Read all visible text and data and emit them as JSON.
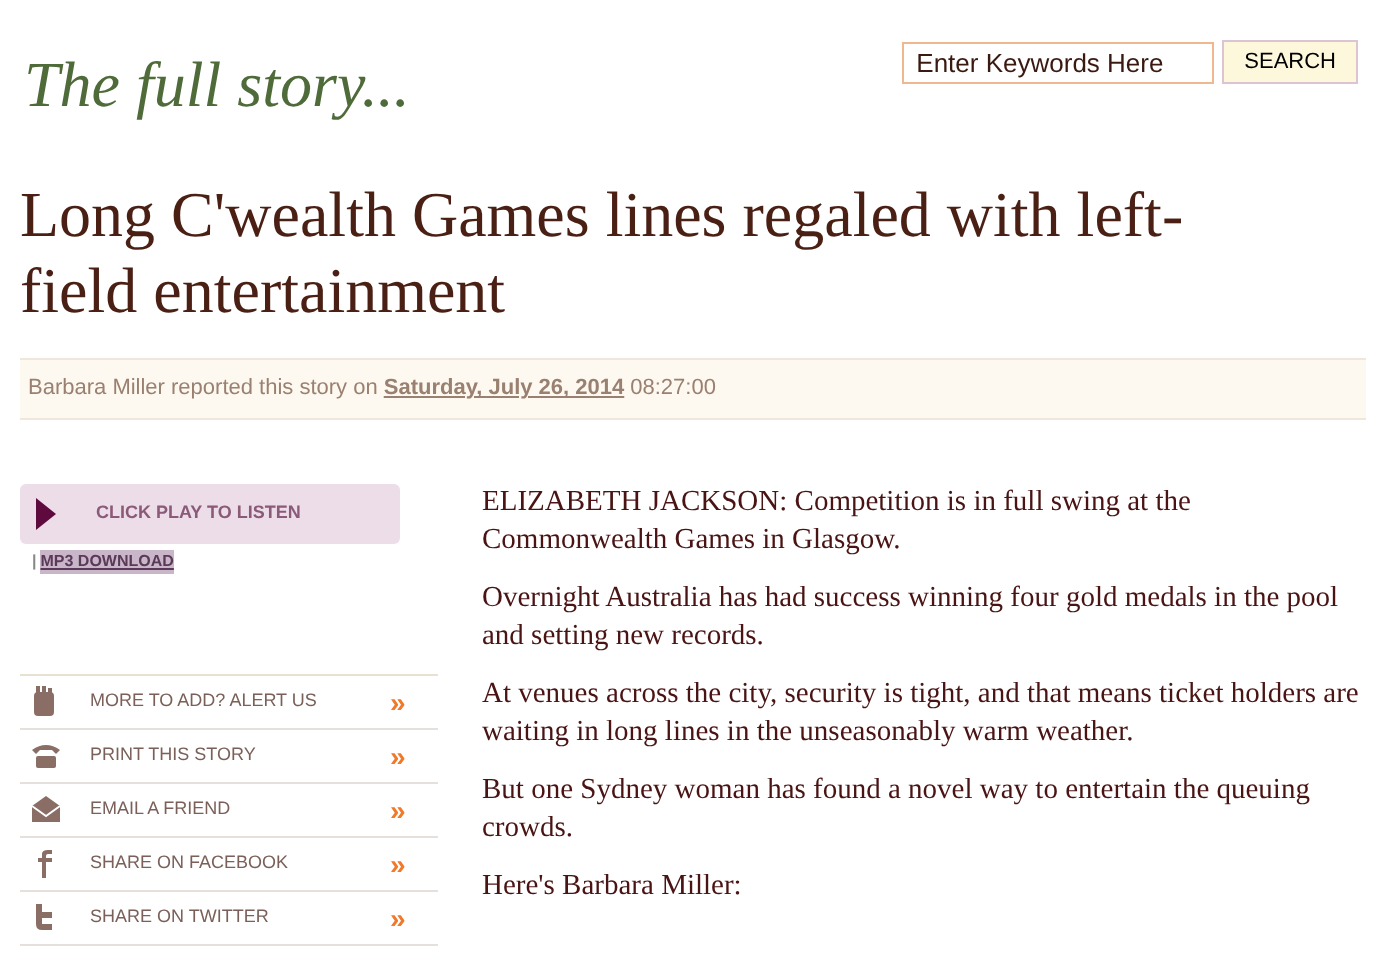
{
  "section_title": "The full story...",
  "search": {
    "value": "Enter Keywords Here",
    "button": "SEARCH"
  },
  "headline": "Long C'wealth Games lines regaled with left-field entertainment",
  "byline": {
    "text": "Barbara Miller reported this story on",
    "date": "Saturday, July 26, 2014",
    "time": "08:27:00"
  },
  "audio": {
    "play_label": "CLICK PLAY TO LISTEN",
    "separator": "|",
    "download": "MP3 DOWNLOAD"
  },
  "actions": [
    {
      "kind": "hand",
      "label": "MORE TO ADD? ALERT US",
      "arrow": "»"
    },
    {
      "kind": "print",
      "label": "PRINT THIS STORY",
      "arrow": "»"
    },
    {
      "kind": "email",
      "label": "EMAIL A FRIEND",
      "arrow": "»"
    },
    {
      "kind": "facebook",
      "label": "SHARE ON FACEBOOK",
      "arrow": "»"
    },
    {
      "kind": "twitter",
      "label": "SHARE ON TWITTER",
      "arrow": "»"
    }
  ],
  "paragraphs": [
    "ELIZABETH JACKSON: Competition is in full swing at the Commonwealth Games in Glasgow.",
    "Overnight Australia has had success winning four gold medals in the pool and setting new records.",
    "At venues across the city, security is tight, and that means ticket holders are waiting in long lines in the unseasonably warm weather.",
    "But one Sydney woman has found a novel way to entertain the queuing crowds.",
    "Here's Barbara Miller:"
  ]
}
